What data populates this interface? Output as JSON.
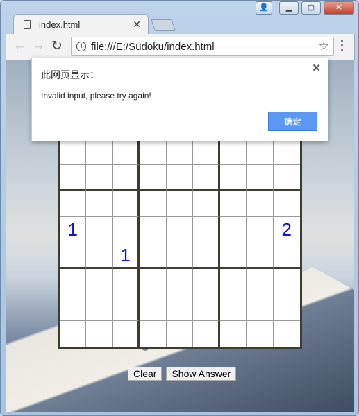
{
  "browser": {
    "tab_title": "index.html",
    "url": "file:///E:/Sudoku/index.html"
  },
  "dialog": {
    "title": "此网页显示：",
    "message": "Invalid input, please try again!",
    "ok_label": "确定"
  },
  "sudoku": {
    "cells": [
      [
        "",
        "",
        "",
        "",
        "",
        "",
        "",
        "",
        ""
      ],
      [
        "",
        "",
        "",
        "",
        "",
        "",
        "",
        "",
        ""
      ],
      [
        "",
        "",
        "",
        "",
        "",
        "",
        "",
        "",
        ""
      ],
      [
        "",
        "",
        "",
        "",
        "",
        "",
        "",
        "",
        ""
      ],
      [
        "1",
        "",
        "",
        "",
        "",
        "",
        "",
        "",
        "2"
      ],
      [
        "",
        "",
        "1",
        "",
        "",
        "",
        "",
        "",
        ""
      ],
      [
        "",
        "",
        "",
        "",
        "",
        "",
        "",
        "",
        ""
      ],
      [
        "",
        "",
        "",
        "",
        "",
        "",
        "",
        "",
        ""
      ],
      [
        "",
        "",
        "",
        "",
        "",
        "",
        "",
        "",
        ""
      ]
    ],
    "digit_color": "#1010e0"
  },
  "buttons": {
    "clear": "Clear",
    "show_answer": "Show Answer"
  }
}
